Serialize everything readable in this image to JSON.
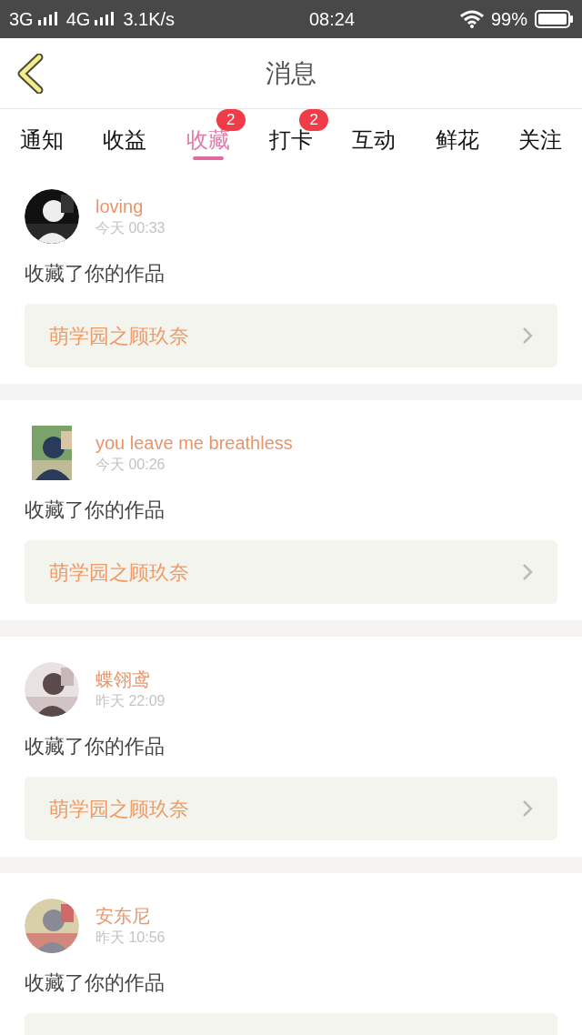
{
  "status_bar": {
    "network_1": "3G",
    "network_2": "4G",
    "speed": "3.1K/s",
    "time": "08:24",
    "battery": "99%"
  },
  "header": {
    "title": "消息"
  },
  "tabs": [
    {
      "label": "通知",
      "selected": false
    },
    {
      "label": "收益",
      "selected": false
    },
    {
      "label": "收藏",
      "selected": true,
      "badge": "2"
    },
    {
      "label": "打卡",
      "selected": false,
      "badge": "2"
    },
    {
      "label": "互动",
      "selected": false
    },
    {
      "label": "鲜花",
      "selected": false
    },
    {
      "label": "关注",
      "selected": false
    }
  ],
  "messages": [
    {
      "name": "loving",
      "time": "今天 00:33",
      "text": "收藏了你的作品",
      "work": "萌学园之顾玖奈"
    },
    {
      "name": "you leave me breathless",
      "time": "今天 00:26",
      "text": "收藏了你的作品",
      "work": "萌学园之顾玖奈"
    },
    {
      "name": "蝶翎鸢",
      "time": "昨天 22:09",
      "text": "收藏了你的作品",
      "work": "萌学园之顾玖奈"
    },
    {
      "name": "安东尼",
      "time": "昨天 10:56",
      "text": "收藏了你的作品"
    }
  ]
}
